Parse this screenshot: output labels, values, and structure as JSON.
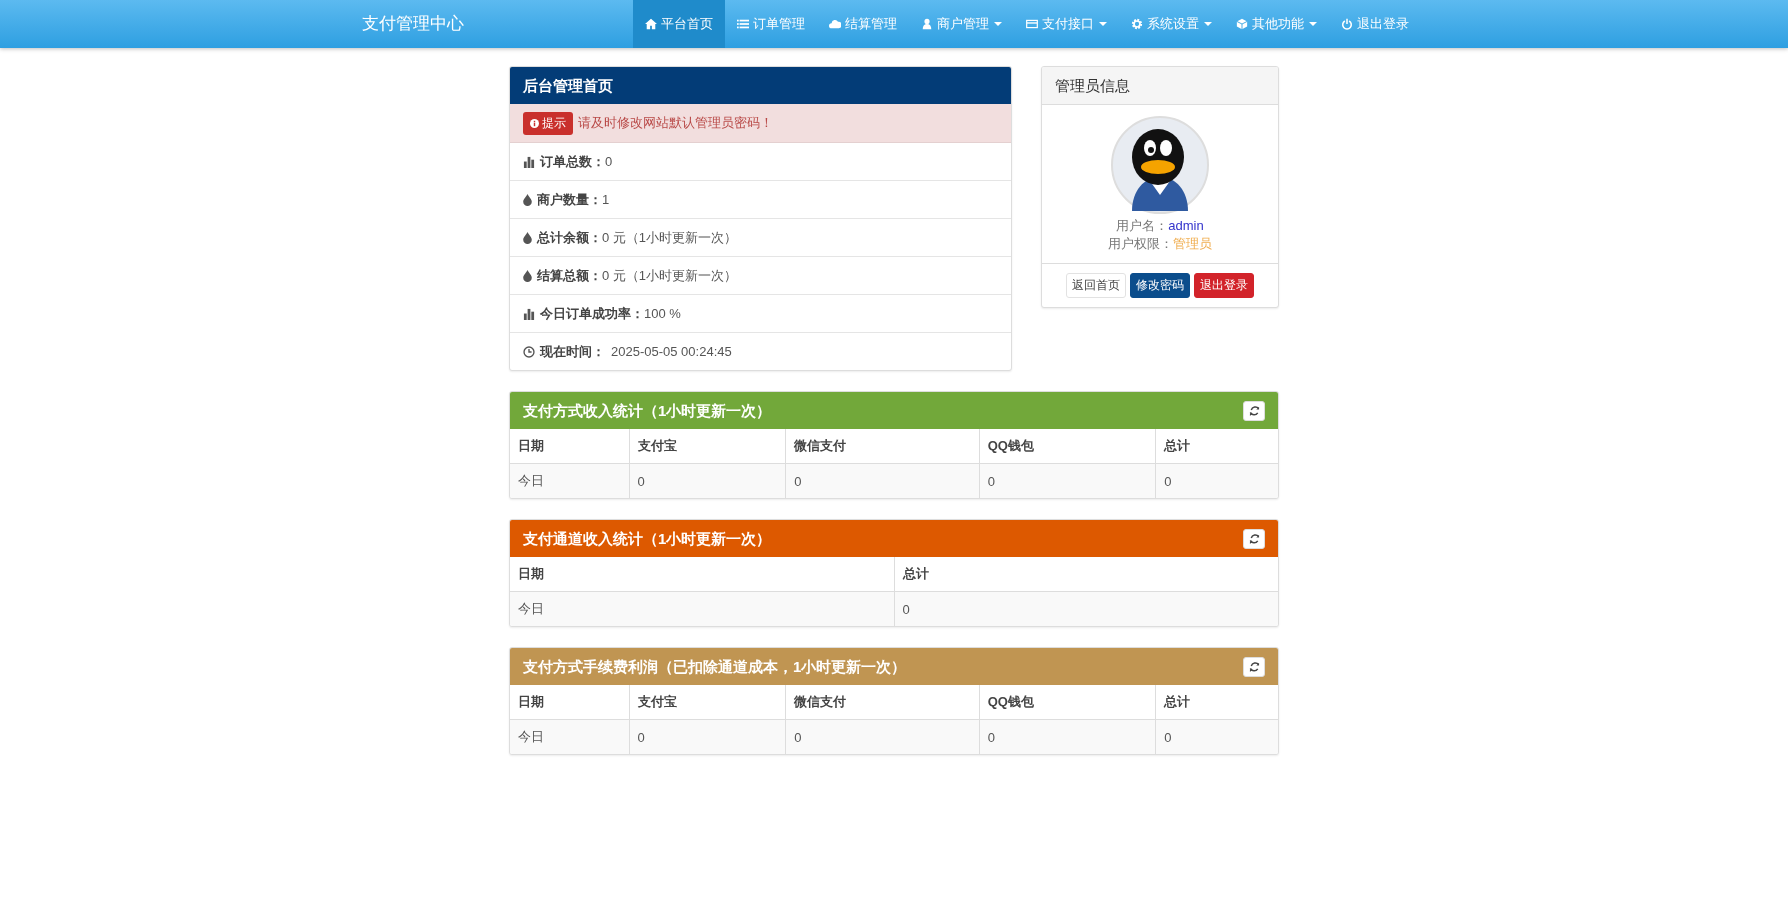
{
  "navbar": {
    "brand": "支付管理中心",
    "items": [
      {
        "label": "平台首页",
        "kind": "home",
        "selected": true,
        "dropdown": false
      },
      {
        "label": "订单管理",
        "kind": "list",
        "selected": false,
        "dropdown": false
      },
      {
        "label": "结算管理",
        "kind": "cloud",
        "selected": false,
        "dropdown": false
      },
      {
        "label": "商户管理",
        "kind": "user",
        "selected": false,
        "dropdown": true
      },
      {
        "label": "支付接口",
        "kind": "card",
        "selected": false,
        "dropdown": true
      },
      {
        "label": "系统设置",
        "kind": "gear",
        "selected": false,
        "dropdown": true
      },
      {
        "label": "其他功能",
        "kind": "cube",
        "selected": false,
        "dropdown": true
      },
      {
        "label": "退出登录",
        "kind": "power",
        "selected": false,
        "dropdown": false
      }
    ]
  },
  "overview": {
    "title": "后台管理首页",
    "alert": {
      "badge": "提示",
      "message": "请及时修改网站默认管理员密码！"
    },
    "stats": [
      {
        "kind": "chart",
        "label": "订单总数：",
        "value": "0"
      },
      {
        "kind": "drop",
        "label": "商户数量：",
        "value": "1"
      },
      {
        "kind": "drop",
        "label": "总计余额：",
        "value": "0 元（1小时更新一次）"
      },
      {
        "kind": "drop",
        "label": "结算总额：",
        "value": "0 元（1小时更新一次）"
      },
      {
        "kind": "chart",
        "label": "今日订单成功率：",
        "value": "100 %"
      },
      {
        "kind": "clock",
        "label": "现在时间：",
        "value": "2025-05-05 00:24:45"
      }
    ]
  },
  "admin_info": {
    "title": "管理员信息",
    "username_label": "用户名：",
    "username": "admin",
    "role_label": "用户权限：",
    "role": "管理员",
    "buttons": [
      {
        "label": "返回首页",
        "kind": "default"
      },
      {
        "label": "修改密码",
        "kind": "primary"
      },
      {
        "label": "退出登录",
        "kind": "danger"
      }
    ]
  },
  "tables": [
    {
      "title": "支付方式收入统计（1小时更新一次）",
      "color": "#72a83a",
      "columns": [
        "日期",
        "支付宝",
        "微信支付",
        "QQ钱包",
        "总计"
      ],
      "rows": [
        [
          "今日",
          "0",
          "0",
          "0",
          "0"
        ]
      ]
    },
    {
      "title": "支付通道收入统计（1小时更新一次）",
      "color": "#dd5900",
      "columns": [
        "日期",
        "总计"
      ],
      "rows": [
        [
          "今日",
          "0"
        ]
      ]
    },
    {
      "title": "支付方式手续费利润（已扣除通道成本，1小时更新一次）",
      "color": "#c09552",
      "columns": [
        "日期",
        "支付宝",
        "微信支付",
        "QQ钱包",
        "总计"
      ],
      "rows": [
        [
          "今日",
          "0",
          "0",
          "0",
          "0"
        ]
      ]
    }
  ]
}
